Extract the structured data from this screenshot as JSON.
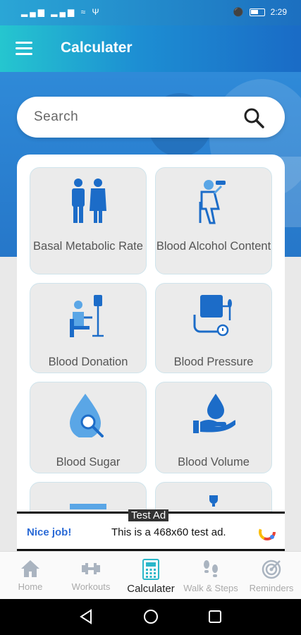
{
  "status": {
    "signal": "▂▄▆ ▂▄▆ ≈ Ψ",
    "time": "2:29"
  },
  "header": {
    "title": "Calculater"
  },
  "search": {
    "placeholder": "Search"
  },
  "cards": [
    {
      "label": "Basal Metabolic Rate",
      "icon": "couple-icon"
    },
    {
      "label": "Blood Alcohol Content",
      "icon": "drinking-person-icon"
    },
    {
      "label": "Blood Donation",
      "icon": "blood-donation-icon"
    },
    {
      "label": "Blood Pressure",
      "icon": "blood-pressure-icon"
    },
    {
      "label": "Blood Sugar",
      "icon": "blood-sugar-icon"
    },
    {
      "label": "Blood Volume",
      "icon": "blood-volume-icon"
    }
  ],
  "ad": {
    "tag": "Test Ad",
    "nice": "Nice job!",
    "text": "This is a 468x60 test ad."
  },
  "nav": [
    {
      "label": "Home",
      "icon": "home-icon"
    },
    {
      "label": "Workouts",
      "icon": "dumbbell-icon"
    },
    {
      "label": "Calculater",
      "icon": "calculator-icon",
      "active": true
    },
    {
      "label": "Walk & Steps",
      "icon": "footsteps-icon"
    },
    {
      "label": "Reminders",
      "icon": "target-icon"
    }
  ],
  "colors": {
    "accent": "#1e7ad0",
    "icon_blue": "#1c6cc8",
    "light_blue": "#5aa6e6"
  }
}
